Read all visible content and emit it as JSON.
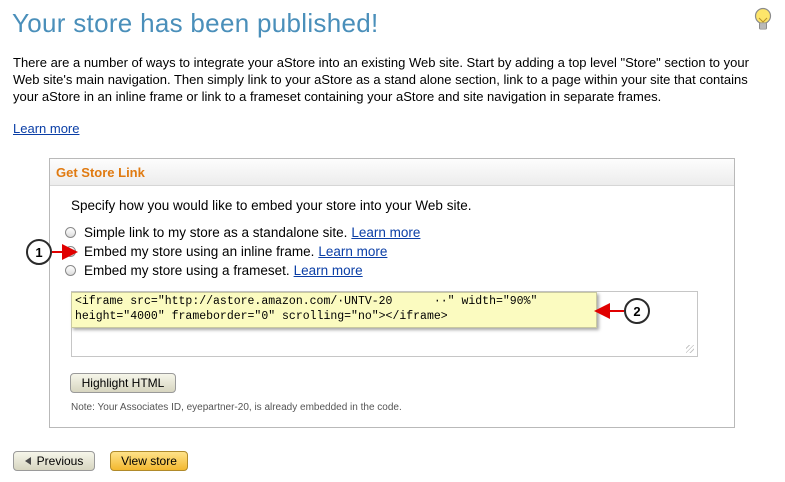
{
  "page": {
    "title": "Your store has been published!",
    "intro": "There are a number of ways to integrate your aStore into an existing Web site. Start by adding a top level \"Store\" section to your Web site's main navigation. Then simply link to your aStore as a stand alone section, link to a page within your site that contains your aStore in an inline frame or link to a frameset containing your aStore and site navigation in separate frames.",
    "learn_more": "Learn more"
  },
  "panel": {
    "title": "Get Store Link",
    "instruction": "Specify how you would like to embed your store into your Web site.",
    "options": [
      {
        "label": "Simple link to my store as a standalone site.",
        "link": "Learn more",
        "selected": false
      },
      {
        "label": "Embed my store using an inline frame.",
        "link": "Learn more",
        "selected": true
      },
      {
        "label": "Embed my store using a frameset.",
        "link": "Learn more",
        "selected": false
      }
    ],
    "code_line1": "<iframe src=\"http://astore.amazon.com/·UNTV-20      ··\" width=\"90%\"",
    "code_line2": "height=\"4000\" frameborder=\"0\" scrolling=\"no\"></iframe>",
    "highlight_button": "Highlight HTML",
    "note": "Note: Your Associates ID, eyepartner-20, is already embedded in the code."
  },
  "footer": {
    "previous_button": "Previous",
    "view_store_button": "View store"
  },
  "callouts": {
    "one": "1",
    "two": "2"
  },
  "colors": {
    "title": "#4a8fba",
    "panel_title": "#e07a10",
    "link": "#0a3ea6",
    "arrow": "#e00000",
    "highlight": "#fbfbc0"
  },
  "icons": {
    "bulb": "lightbulb-icon",
    "prev": "triangle-left-icon"
  }
}
